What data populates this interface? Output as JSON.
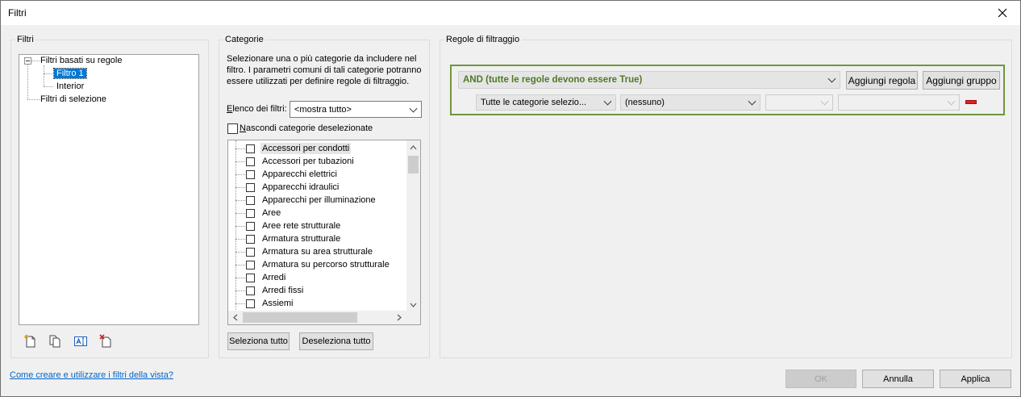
{
  "window": {
    "title": "Filtri"
  },
  "filters_panel": {
    "legend": "Filtri",
    "tree": [
      {
        "label": "Filtri basati su regole",
        "selected": false
      },
      {
        "label": "Filtro 1",
        "selected": true
      },
      {
        "label": "Interior",
        "selected": false
      },
      {
        "label": "Filtri di selezione",
        "selected": false
      }
    ],
    "toolbar_icons": [
      "new-filter-icon",
      "duplicate-filter-icon",
      "rename-filter-icon",
      "delete-filter-icon"
    ]
  },
  "categories_panel": {
    "legend": "Categorie",
    "description": "Selezionare una o più categorie da includere nel filtro. I parametri comuni di tali categorie potranno essere utilizzati per definire regole di filtraggio.",
    "filter_list_label": "Elenco dei filtri:",
    "filter_list_value": "<mostra tutto>",
    "hide_unchecked_label": "Nascondi categorie deselezionate",
    "items": [
      "Accessori per condotti",
      "Accessori per tubazioni",
      "Apparecchi elettrici",
      "Apparecchi idraulici",
      "Apparecchi per illuminazione",
      "Aree",
      "Aree rete strutturale",
      "Armatura strutturale",
      "Armatura su area strutturale",
      "Armatura su percorso strutturale",
      "Arredi",
      "Arredi fissi",
      "Assiemi"
    ],
    "select_all": "Seleziona tutto",
    "deselect_all": "Deseleziona tutto"
  },
  "rules_panel": {
    "legend": "Regole di filtraggio",
    "group_operator": "AND (tutte le regole devono essere True)",
    "add_rule": "Aggiungi regola",
    "add_group": "Aggiungi gruppo",
    "rule_category": "Tutte le categorie selezio...",
    "rule_parameter": "(nessuno)",
    "rule_operator": "",
    "rule_value": ""
  },
  "footer": {
    "help_link": "Come creare e utilizzare i filtri della vista?",
    "ok": "OK",
    "cancel": "Annulla",
    "apply": "Applica"
  },
  "colors": {
    "accent": "#0078d7",
    "group_border": "#70963c",
    "group_text": "#4f7a28",
    "remove_rule": "#e02020",
    "link": "#0066cc"
  }
}
